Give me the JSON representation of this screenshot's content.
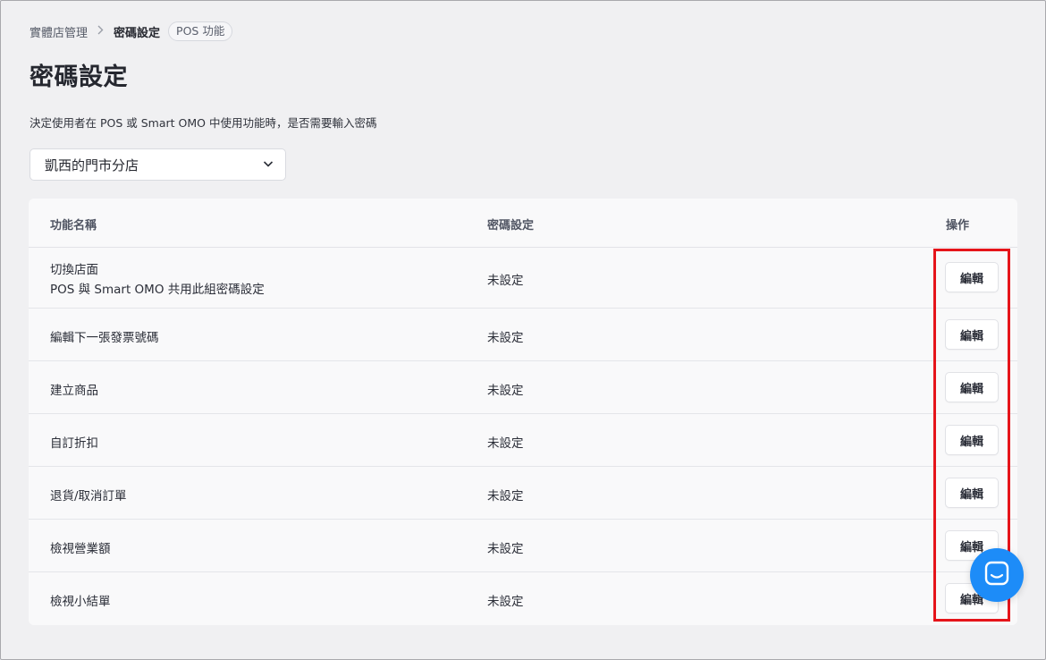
{
  "breadcrumb": {
    "parent": "實體店管理",
    "current": "密碼設定",
    "badge": "POS 功能"
  },
  "page": {
    "title": "密碼設定",
    "description": "決定使用者在 POS 或 Smart OMO 中使用功能時，是否需要輸入密碼"
  },
  "store_select": {
    "value": "凱西的門市分店",
    "icon": "chevron-down-icon"
  },
  "table": {
    "headers": [
      "功能名稱",
      "密碼設定",
      "操作"
    ],
    "rows": [
      {
        "name": "切換店面",
        "sub": "POS 與 Smart OMO 共用此組密碼設定",
        "status": "未設定",
        "action": "編輯"
      },
      {
        "name": "編輯下一張發票號碼",
        "status": "未設定",
        "action": "編輯"
      },
      {
        "name": "建立商品",
        "status": "未設定",
        "action": "編輯"
      },
      {
        "name": "自訂折扣",
        "status": "未設定",
        "action": "編輯"
      },
      {
        "name": "退貨/取消訂單",
        "status": "未設定",
        "action": "編輯"
      },
      {
        "name": "檢視營業額",
        "status": "未設定",
        "action": "編輯"
      },
      {
        "name": "檢視小結單",
        "status": "未設定",
        "action": "編輯"
      }
    ]
  },
  "colors": {
    "highlight": "#e5141a",
    "chat_accent": "#1d8cf8",
    "background": "#f0f0f2"
  },
  "chat": {
    "icon": "chat-icon"
  }
}
